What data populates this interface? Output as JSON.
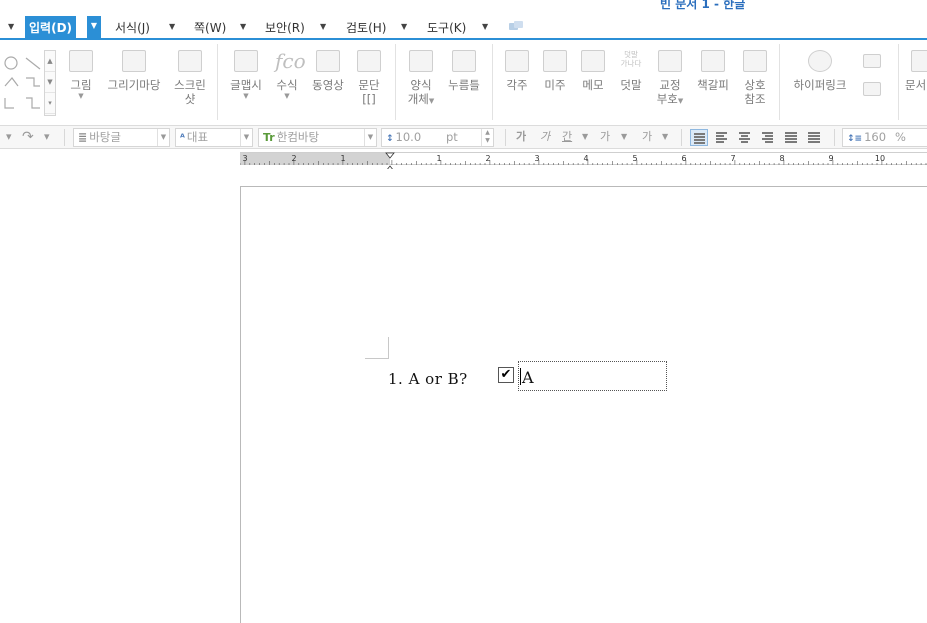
{
  "window": {
    "title": "빈 문서 1 - 한글"
  },
  "menubar": {
    "items": [
      {
        "label": "입력(D)",
        "active": true
      },
      {
        "label": "서식(J)"
      },
      {
        "label": "쪽(W)"
      },
      {
        "label": "보안(R)"
      },
      {
        "label": "검토(H)"
      },
      {
        "label": "도구(K)"
      }
    ]
  },
  "ribbon": {
    "buttons": {
      "picture": "그림",
      "clipart": "그리기마당",
      "screenshot_line1": "스크린",
      "screenshot_line2": "샷",
      "glyph": "글맵시",
      "formula": "수식",
      "video": "동영상",
      "column_line1": "문단",
      "column_line2": "[[]",
      "form_line1": "양식",
      "form_line2": "개체",
      "pushbutton": "누름틀",
      "footnote": "각주",
      "endnote": "미주",
      "memo": "메모",
      "overlap": "덧말",
      "proof_line1": "교정",
      "proof_line2": "부호",
      "bookmark": "책갈피",
      "crossref_line1": "상호",
      "crossref_line2": "참조",
      "hyperlink": "하이퍼링크",
      "document": "문서"
    },
    "overlap_icon_text": "덧말\n가나다"
  },
  "toolbar": {
    "style": "바탕글",
    "lang": "대표",
    "font": "한컴바탕",
    "size": "10.0",
    "unit": "pt",
    "zoom": "160",
    "percent": "%"
  },
  "ruler": {
    "left_labels": [
      "3",
      "2",
      "1"
    ],
    "right_labels": [
      "1",
      "2",
      "3",
      "4",
      "5",
      "6",
      "7",
      "8",
      "9",
      "10"
    ]
  },
  "document": {
    "question": "1. A or B?",
    "checkbox_checked": true,
    "checkbox_mark": "✔",
    "field_value": "A"
  }
}
